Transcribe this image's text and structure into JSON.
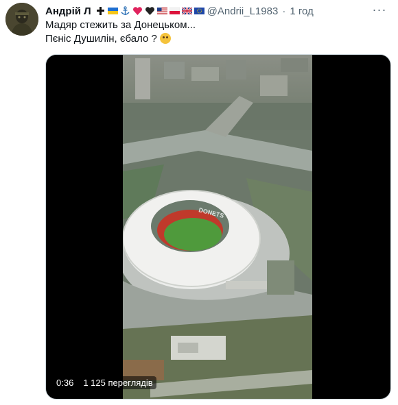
{
  "author": {
    "name": "Андрій Л",
    "handle": "@Andrii_L1983",
    "time": "1 год"
  },
  "badges": [
    "cross-icon",
    "ukraine-flag-icon",
    "anchor-icon",
    "red-heart-icon",
    "black-heart-icon",
    "usa-flag-icon",
    "poland-flag-icon",
    "uk-flag-icon",
    "eu-flag-icon"
  ],
  "tweet": {
    "line1": "Мадяр стежить за Донецьком...",
    "line2": "Пєніс Душилін, єбало ?"
  },
  "video": {
    "duration": "0:36",
    "views": "1 125 переглядів",
    "stadium_roof_text": "DONETS"
  },
  "more_label": "···"
}
